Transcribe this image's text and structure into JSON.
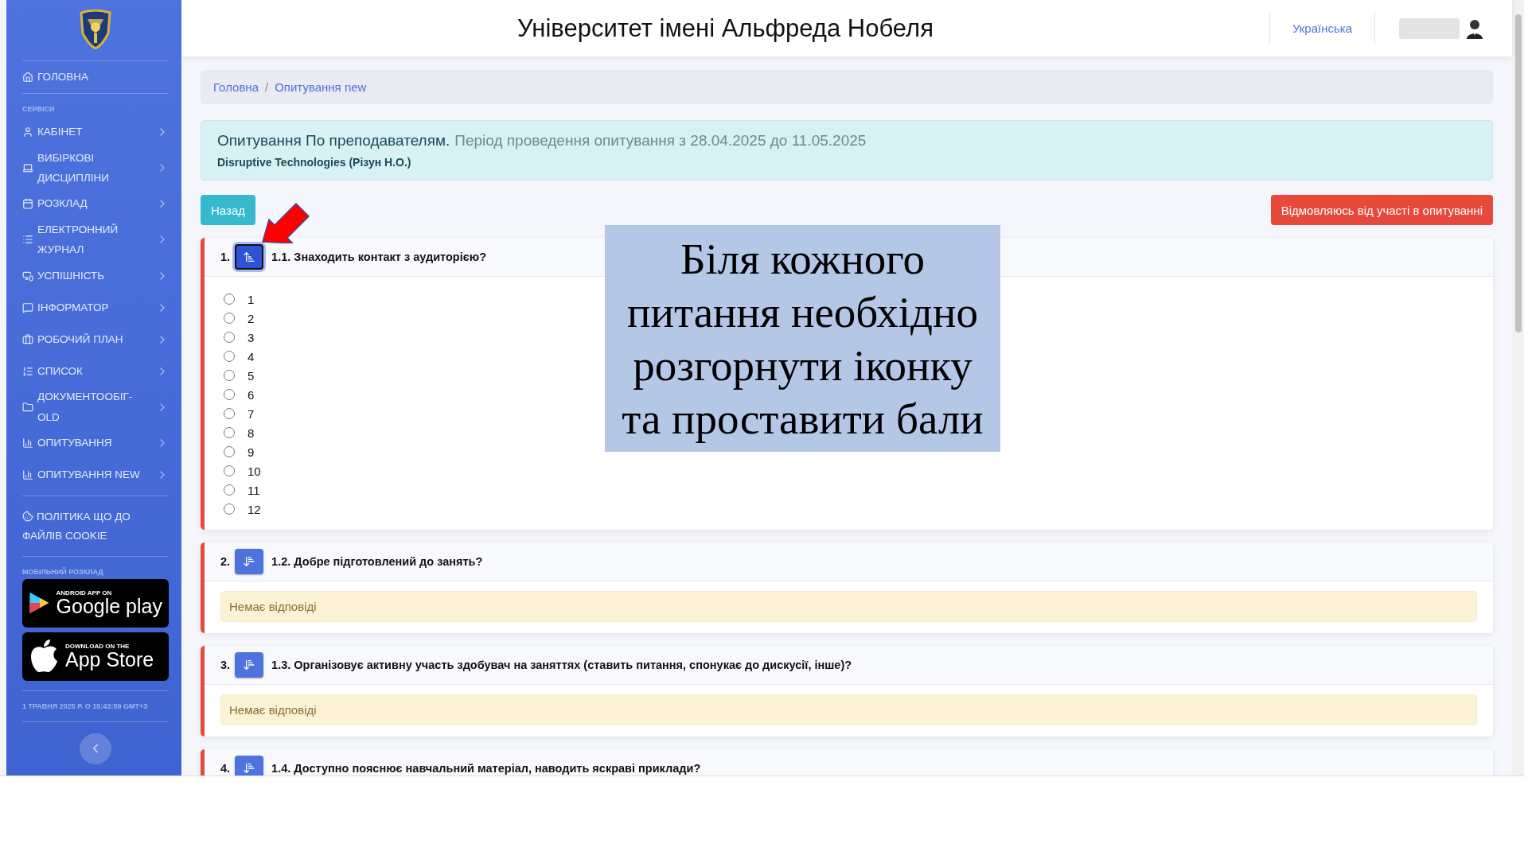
{
  "sidebar": {
    "home": "ГОЛОВНА",
    "section_label": "СЕРВІСИ",
    "items": [
      {
        "label": "КАБІНЕТ",
        "kind": "menu"
      },
      {
        "label": "ВИБІРКОВІ ДИСЦИПЛІНИ",
        "kind": "menu"
      },
      {
        "label": "РОЗКЛАД",
        "kind": "menu"
      },
      {
        "label": "ЕЛЕКТРОННИЙ ЖУРНАЛ",
        "kind": "menu"
      },
      {
        "label": "УСПІШНІСТЬ",
        "kind": "menu"
      },
      {
        "label": "ІНФОРМАТОР",
        "kind": "menu"
      },
      {
        "label": "РОБОЧИЙ ПЛАН",
        "kind": "menu"
      },
      {
        "label": "СПИСОК",
        "kind": "menu"
      },
      {
        "label": "ДОКУМЕНТООБІГ-OLD",
        "kind": "menu"
      },
      {
        "label": "ОПИТУВАННЯ",
        "kind": "menu"
      },
      {
        "label": "ОПИТУВАННЯ NEW",
        "kind": "menu"
      }
    ],
    "cookie": "ПОЛІТИКА ЩО ДО ФАЙЛІВ COOKIE",
    "mobile_label": "МОБІЛЬНИЙ РОЗКЛАД",
    "badges": [
      {
        "kind": "google",
        "small": "ANDROID APP ON",
        "big": "Google play"
      },
      {
        "kind": "apple",
        "small": "DOWNLOAD ON THE",
        "big": "App Store"
      }
    ],
    "datetime": "1 ТРАВНЯ 2025 Р. О 15:43:59 GMT+3"
  },
  "header": {
    "title": "Університет імені Альфреда Нобеля",
    "language": "Українська"
  },
  "breadcrumb": {
    "items": [
      "Головна",
      "Опитування new"
    ],
    "separator": "/"
  },
  "survey": {
    "title": "Опитування По преподавателям.",
    "period": "Період проведення опитування з 28.04.2025 до 11.05.2025",
    "course": "Disruptive Technologies (Різун Н.О.)"
  },
  "back_button": "Назад",
  "decline_button": "Відмовляюсь від участі в опитуванні",
  "questions": [
    {
      "number": "1.",
      "text": "1.1. Знаходить контакт з аудиторією?",
      "expanded": true,
      "options": [
        {
          "label": "1",
          "checked": false
        },
        {
          "label": "2",
          "checked": false
        },
        {
          "label": "3",
          "checked": false
        },
        {
          "label": "4",
          "checked": false
        },
        {
          "label": "5",
          "checked": false
        },
        {
          "label": "6",
          "checked": false
        },
        {
          "label": "7",
          "checked": false
        },
        {
          "label": "8",
          "checked": false
        },
        {
          "label": "9",
          "checked": false
        },
        {
          "label": "10",
          "checked": false
        },
        {
          "label": "11",
          "checked": false
        },
        {
          "label": "12",
          "checked": false
        }
      ]
    },
    {
      "number": "2.",
      "text": "1.2. Добре підготовлений до занять?",
      "expanded": false,
      "no_answer": "Немає відповіді"
    },
    {
      "number": "3.",
      "text": "1.3. Організовує активну участь здобувач на заняттях (ставить питання, спонукає до дискусії, інше)?",
      "expanded": false,
      "no_answer": "Немає відповіді"
    },
    {
      "number": "4.",
      "text": "1.4. Доступно пояснює навчальний матеріал, наводить яскраві приклади?",
      "expanded": false
    }
  ],
  "callout": "Біля кожного питання необхідно розгорнути іконку та проставити бали"
}
